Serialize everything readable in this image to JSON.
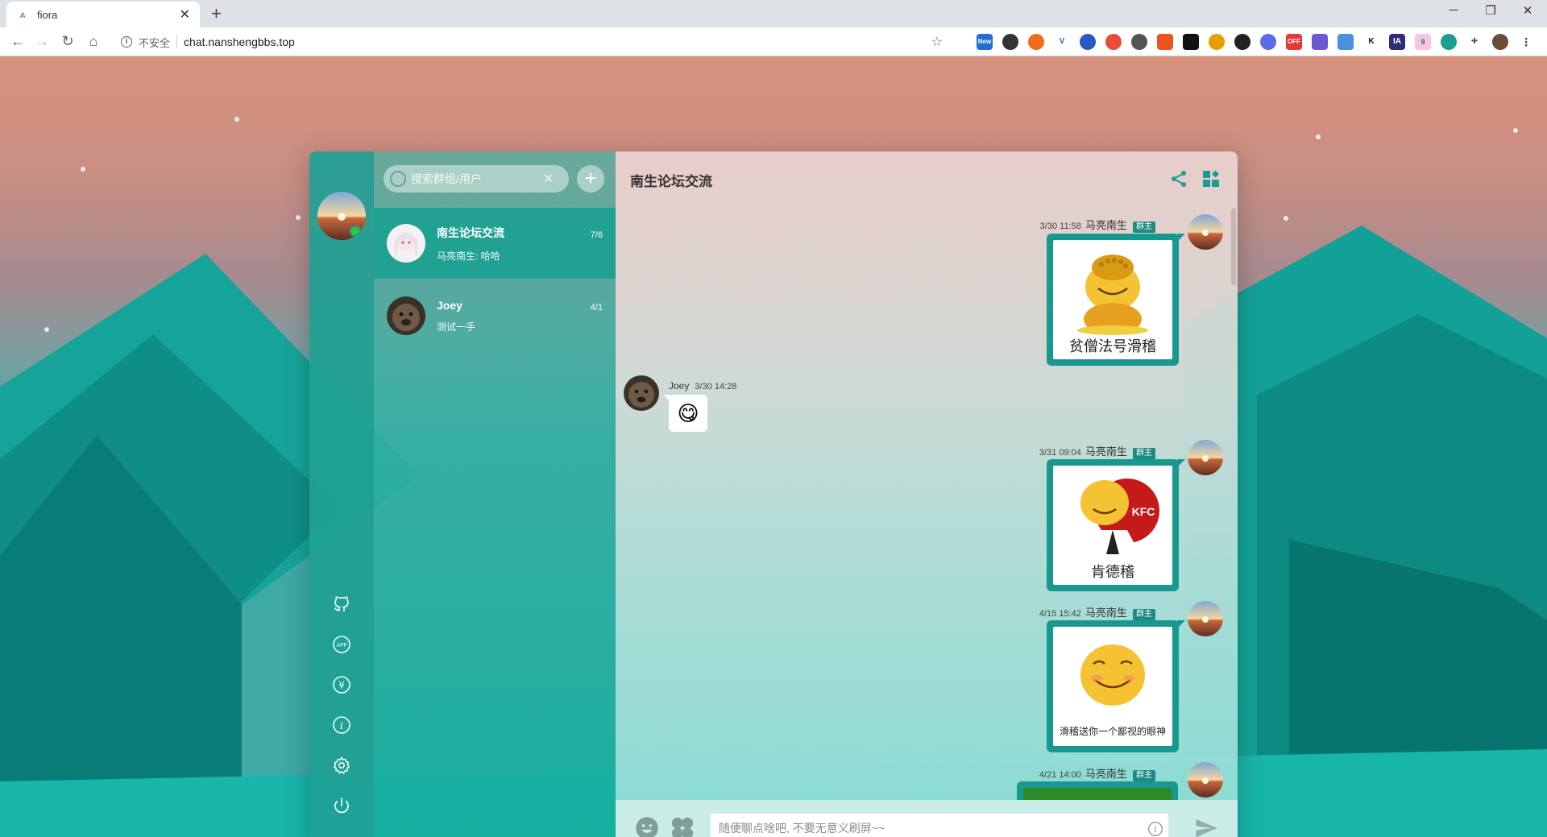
{
  "browser": {
    "tab_title": "fiora",
    "tab_close": "✕",
    "new_tab": "+",
    "insecure_label": "不安全",
    "url": "chat.nanshengbbs.top",
    "window_controls": {
      "minimize": "─",
      "restore": "❐",
      "close": "✕"
    },
    "extensions": [
      "New",
      "",
      "",
      "",
      "",
      "",
      "",
      "",
      "",
      "",
      "",
      "",
      "",
      "OFF",
      "",
      "",
      "K",
      "IA",
      "9",
      "",
      "",
      ""
    ]
  },
  "app": {
    "search_placeholder": "搜索群组/用户",
    "conversations": [
      {
        "name": "南生论坛交流",
        "preview": "马亮南生: 哈哈",
        "date": "7/6"
      },
      {
        "name": "Joey",
        "preview": "测试一手",
        "date": "4/1"
      }
    ],
    "rail_icons": [
      "github-icon",
      "app-icon",
      "yen-icon",
      "info-icon",
      "settings-icon",
      "power-icon"
    ],
    "chat_title": "南生论坛交流",
    "messages": [
      {
        "time": "3/30 11:58",
        "nick": "马亮南生",
        "badge": "群主",
        "caption": "贫僧法号滑稽"
      },
      {
        "time": "3/30 14:28",
        "nick": "Joey",
        "emoji": "😋"
      },
      {
        "time": "3/31 09:04",
        "nick": "马亮南生",
        "badge": "群主",
        "caption": "肯德稽",
        "kfc": "KFC"
      },
      {
        "time": "4/15 15:42",
        "nick": "马亮南生",
        "badge": "群主",
        "caption": "滑稽送你一个鄙视的眼神"
      },
      {
        "time": "4/21 14:00",
        "nick": "马亮南生",
        "badge": "群主"
      }
    ],
    "input_placeholder": "随便聊点啥吧, 不要无意义刷屏~~"
  }
}
